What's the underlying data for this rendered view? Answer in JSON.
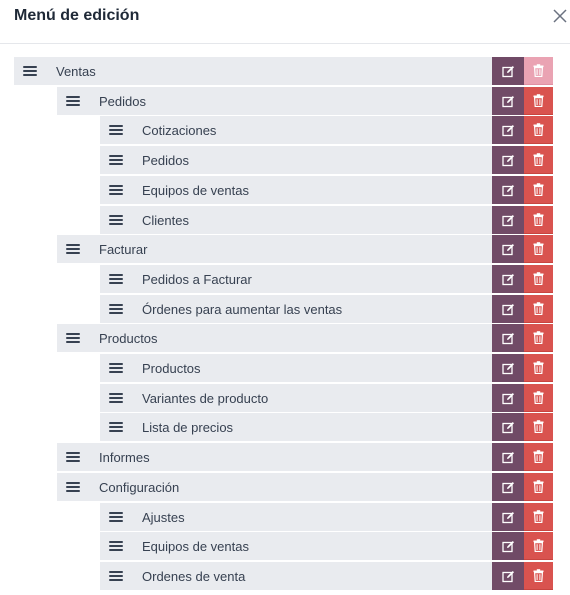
{
  "dialog": {
    "title": "Menú de edición",
    "close_icon": "close-icon"
  },
  "colors": {
    "edit_button": "#714b67",
    "delete_button": "#d9534f",
    "delete_button_first": "#eaa3b3",
    "row_background": "#e9ebef"
  },
  "menu_items": [
    {
      "label": "Ventas",
      "level": 0
    },
    {
      "label": "Pedidos",
      "level": 1
    },
    {
      "label": "Cotizaciones",
      "level": 2
    },
    {
      "label": "Pedidos",
      "level": 2
    },
    {
      "label": "Equipos de ventas",
      "level": 2
    },
    {
      "label": "Clientes",
      "level": 2
    },
    {
      "label": "Facturar",
      "level": 1
    },
    {
      "label": "Pedidos a Facturar",
      "level": 2
    },
    {
      "label": "Órdenes para aumentar las ventas",
      "level": 2
    },
    {
      "label": "Productos",
      "level": 1
    },
    {
      "label": "Productos",
      "level": 2
    },
    {
      "label": "Variantes de producto",
      "level": 2
    },
    {
      "label": "Lista de precios",
      "level": 2
    },
    {
      "label": "Informes",
      "level": 1
    },
    {
      "label": "Configuración",
      "level": 1
    },
    {
      "label": "Ajustes",
      "level": 2
    },
    {
      "label": "Equipos de ventas",
      "level": 2
    },
    {
      "label": "Ordenes de venta",
      "level": 2
    }
  ]
}
